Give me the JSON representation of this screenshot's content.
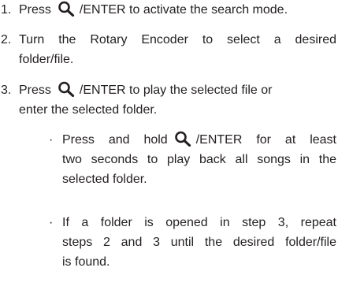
{
  "steps": [
    {
      "number": "1.",
      "before": "Press",
      "after": "/ENTER to activate the search mode."
    },
    {
      "number": "2.",
      "line1": "Turn the Rotary Encoder to select a desired",
      "line2": "folder/file."
    },
    {
      "number": "3.",
      "before": "Press",
      "after": "/ENTER to play the selected file or",
      "line2": "enter the selected folder."
    }
  ],
  "bullets": [
    {
      "mark": "·",
      "before": "Press and hold",
      "after": "/ENTER for at least",
      "line2": "two seconds to play back all songs in the",
      "line3": "selected folder."
    },
    {
      "mark": "·",
      "line1": "If a folder is opened in step 3, repeat",
      "line2": "steps 2 and 3 until the desired folder/file",
      "line3": "is found."
    }
  ],
  "icon": "search-magnifier-icon",
  "colors": {
    "text": "#231f20",
    "background": "#ffffff"
  }
}
